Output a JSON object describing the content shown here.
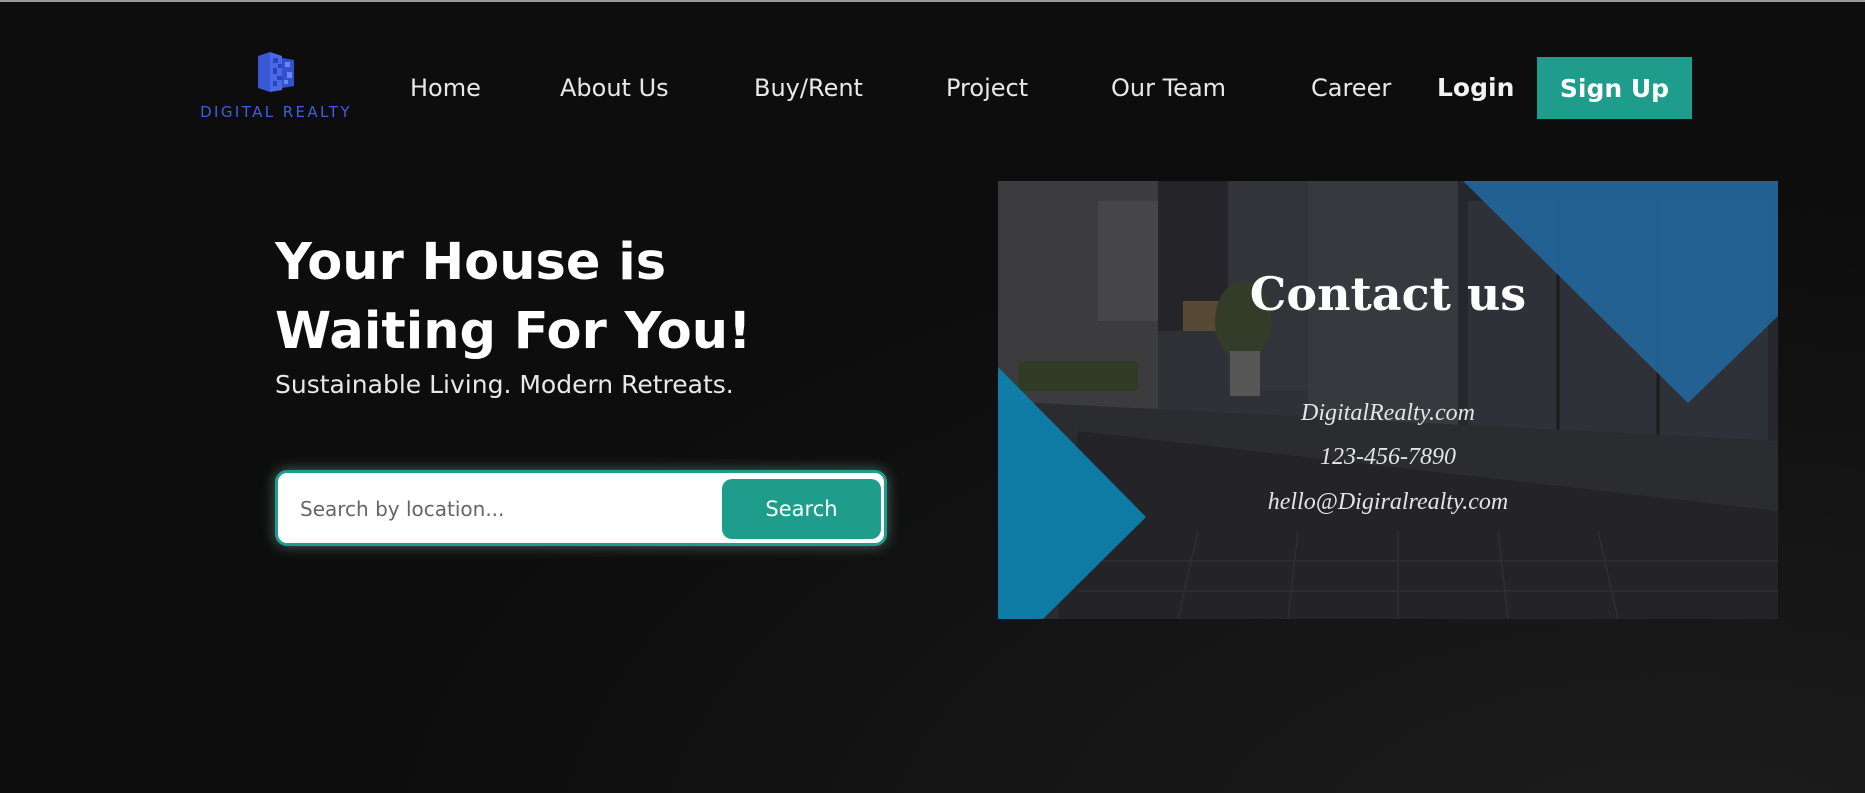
{
  "brand": {
    "name": "DIGITAL REALTY",
    "logo_icon": "building-blocks-icon",
    "color": "#3f5fe0"
  },
  "nav": {
    "items": [
      {
        "label": "Home"
      },
      {
        "label": "About Us"
      },
      {
        "label": "Buy/Rent"
      },
      {
        "label": "Project"
      },
      {
        "label": "Our Team"
      },
      {
        "label": "Career"
      }
    ],
    "login_label": "Login",
    "signup_label": "Sign Up"
  },
  "hero": {
    "title": "Your House is Waiting For You!",
    "subtitle": "Sustainable Living. Modern Retreats.",
    "search": {
      "placeholder": "Search by location...",
      "button_label": "Search"
    }
  },
  "contact": {
    "title": "Contact us",
    "website": "DigitalRealty.com",
    "phone": "123-456-7890",
    "email": "hello@Digiralrealty.com"
  },
  "colors": {
    "accent": "#1e9d8c",
    "background": "#0d0d0d",
    "triangle_blue": "#2b7fc4",
    "triangle_cyan": "#0f9fd6"
  }
}
